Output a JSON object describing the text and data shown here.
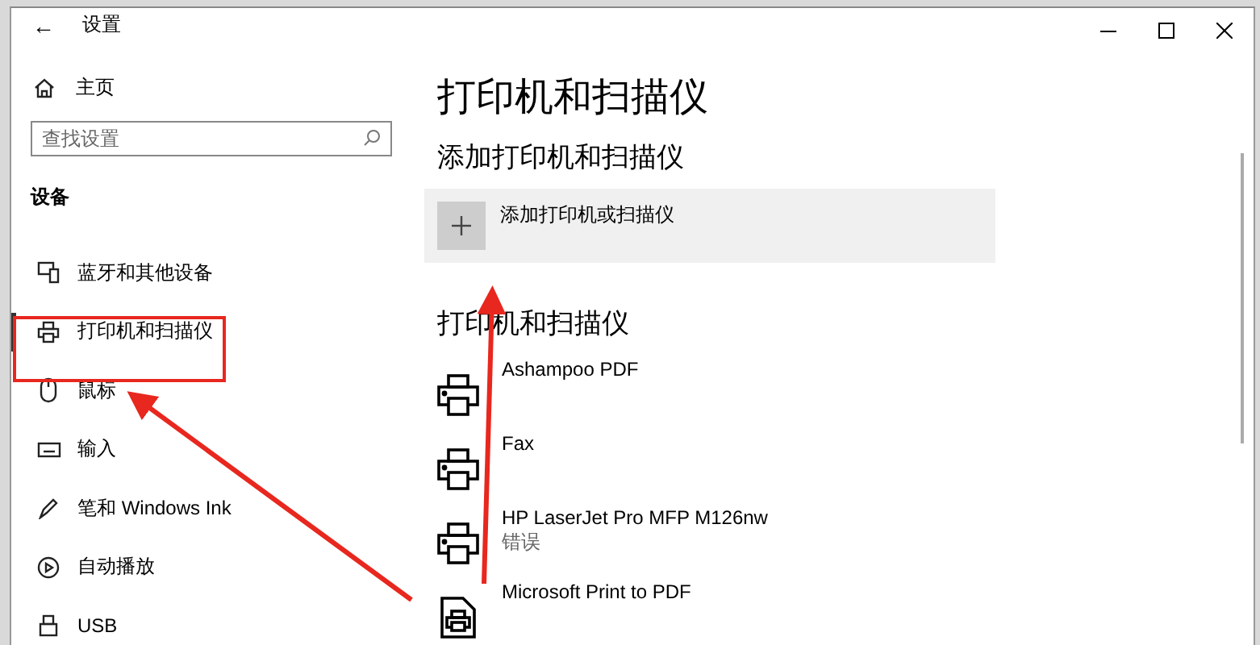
{
  "window": {
    "back": "←",
    "title": "设置"
  },
  "sidebar": {
    "home": "主页",
    "search": {
      "placeholder": "查找设置"
    },
    "section": "设备",
    "items": [
      {
        "label": "蓝牙和其他设备",
        "kind": "bluetooth",
        "selected": false
      },
      {
        "label": "打印机和扫描仪",
        "kind": "printer",
        "selected": true
      },
      {
        "label": "鼠标",
        "kind": "mouse",
        "selected": false
      },
      {
        "label": "输入",
        "kind": "keyboard",
        "selected": false
      },
      {
        "label": "笔和 Windows Ink",
        "kind": "pen",
        "selected": false
      },
      {
        "label": "自动播放",
        "kind": "autoplay",
        "selected": false
      },
      {
        "label": "USB",
        "kind": "usb",
        "selected": false
      }
    ]
  },
  "main": {
    "title": "打印机和扫描仪",
    "add_heading": "添加打印机和扫描仪",
    "add_button": "添加打印机或扫描仪",
    "printers_heading": "打印机和扫描仪",
    "printers": [
      {
        "name": "Ashampoo PDF",
        "kind": "printer"
      },
      {
        "name": "Fax",
        "kind": "printer"
      },
      {
        "name": "HP LaserJet Pro MFP M126nw",
        "status": "错误",
        "kind": "printer"
      },
      {
        "name": "Microsoft Print to PDF",
        "kind": "document"
      }
    ]
  }
}
